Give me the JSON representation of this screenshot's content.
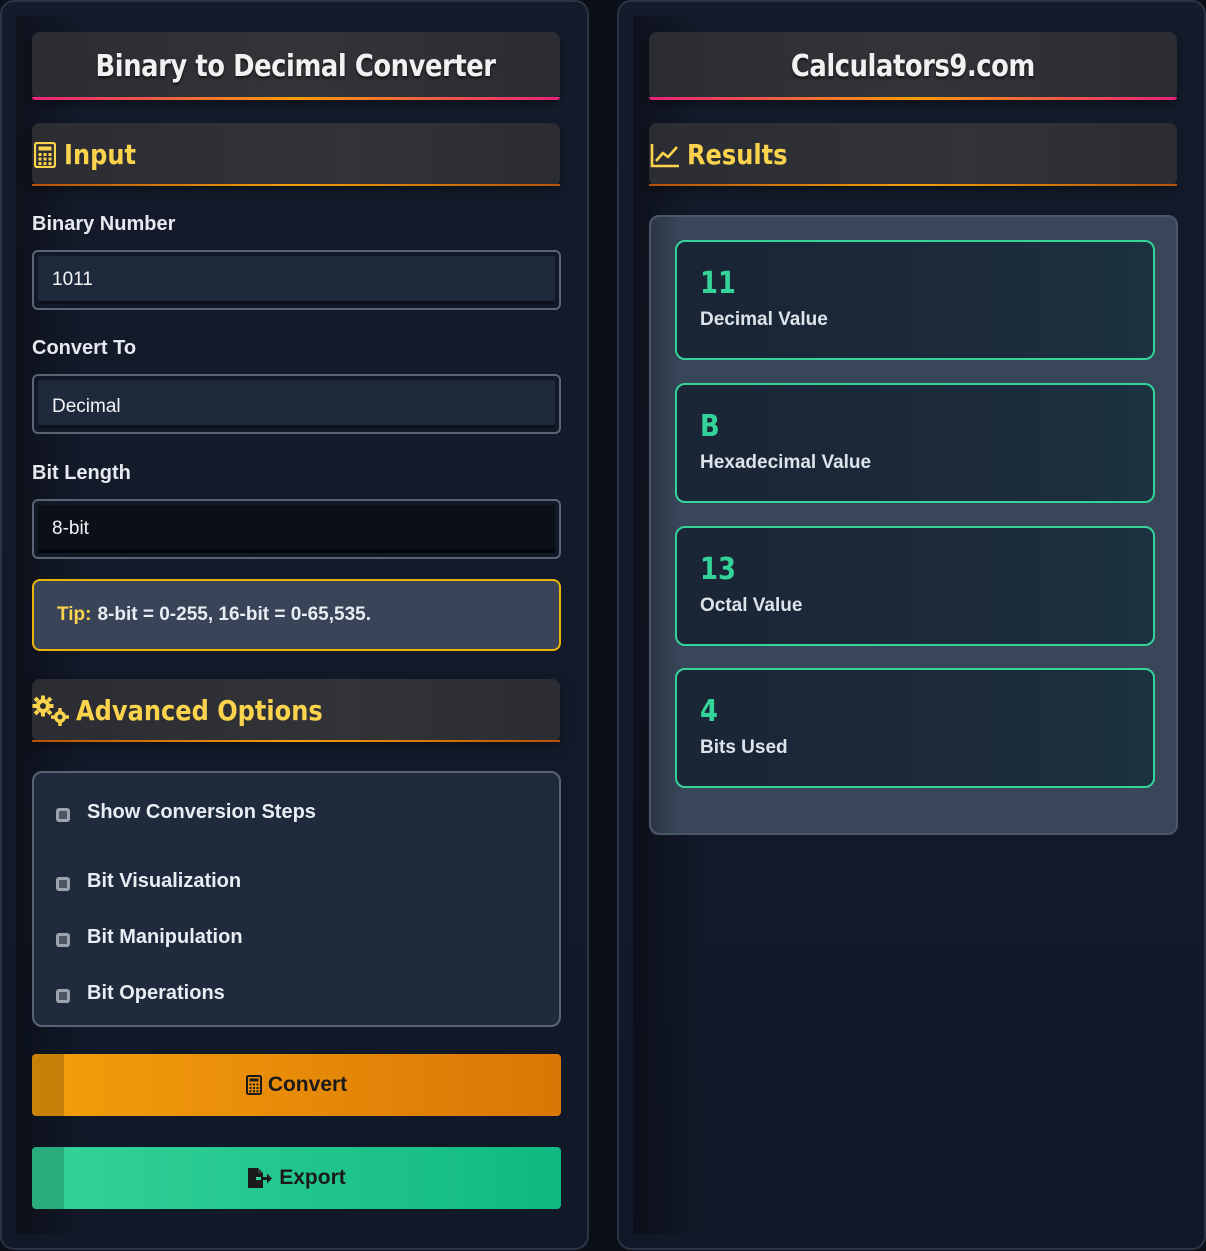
{
  "left_panel": {
    "title": "Binary to Decimal Converter",
    "input_section": {
      "title": "Input",
      "icon": "calculator-icon"
    },
    "binary_number": {
      "label": "Binary Number",
      "value": "1011"
    },
    "convert_to": {
      "label": "Convert To",
      "value": "Decimal"
    },
    "bit_length": {
      "label": "Bit Length",
      "value": "8-bit"
    },
    "tip": {
      "label": "Tip:",
      "text": "8-bit = 0-255, 16-bit = 0-65,535."
    },
    "advanced_section": {
      "title": "Advanced Options",
      "icon": "gears-icon"
    },
    "options": [
      {
        "label": "Show Conversion Steps",
        "checked": false
      },
      {
        "label": "Bit Visualization",
        "checked": false
      },
      {
        "label": "Bit Manipulation",
        "checked": false
      },
      {
        "label": "Bit Operations",
        "checked": false
      }
    ],
    "convert_button": {
      "label": "Convert",
      "icon": "calculator-icon"
    },
    "export_button": {
      "label": "Export",
      "icon": "file-export-icon"
    }
  },
  "right_panel": {
    "title": "Calculators9.com",
    "results_section": {
      "title": "Results",
      "icon": "chart-line-icon"
    },
    "results": [
      {
        "value": "11",
        "caption": "Decimal Value"
      },
      {
        "value": "B",
        "caption": "Hexadecimal Value"
      },
      {
        "value": "13",
        "caption": "Octal Value"
      },
      {
        "value": "4",
        "caption": "Bits Used"
      }
    ]
  },
  "colors": {
    "accent_yellow": "#fcd34d",
    "accent_green": "#34d399",
    "convert_orange": "#f59e0b",
    "header_underline_pink": "#e8237a"
  }
}
